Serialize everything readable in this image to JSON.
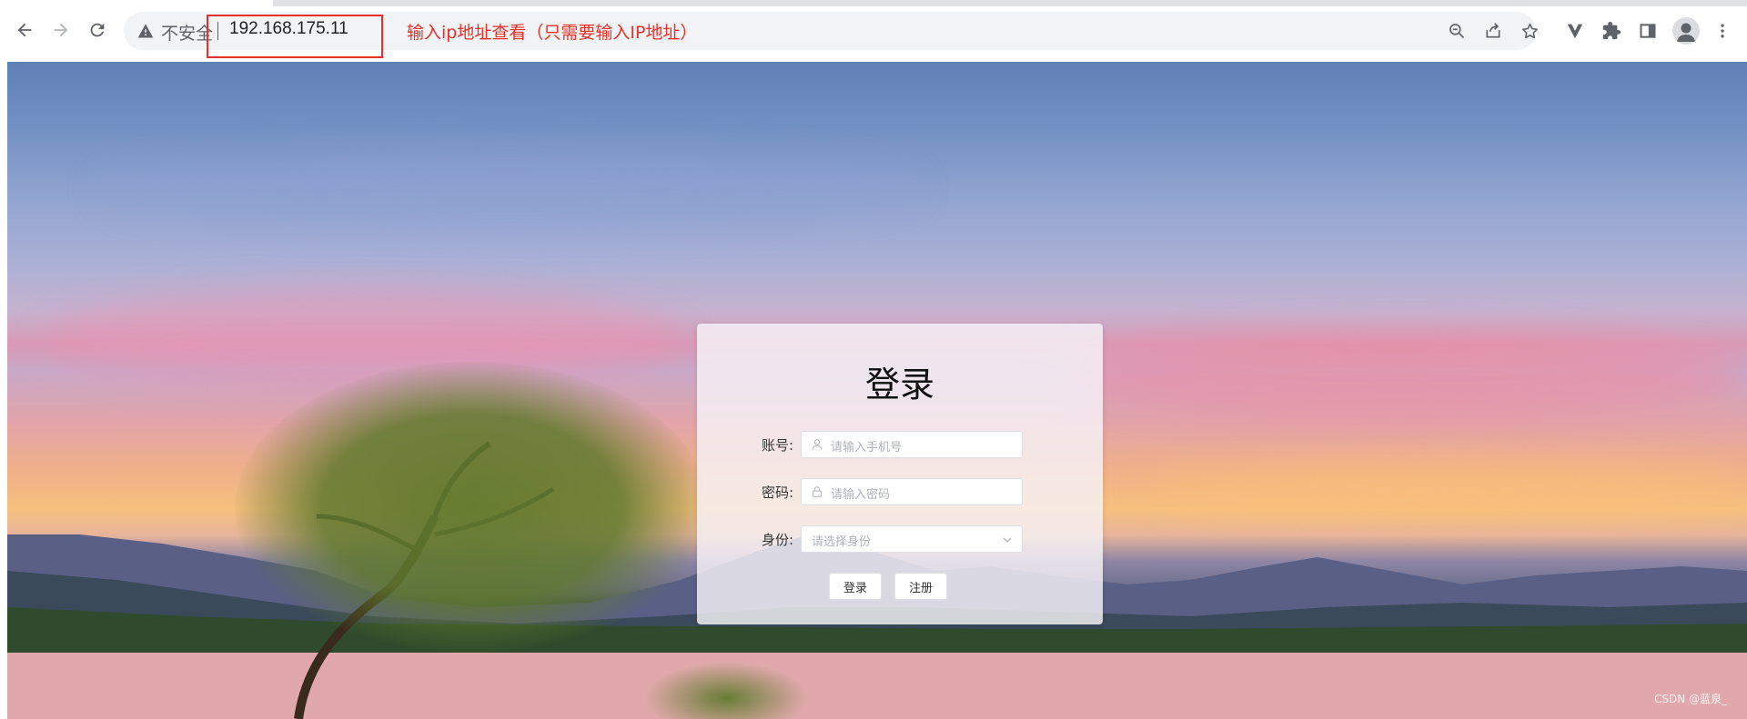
{
  "browser": {
    "security_label": "不安全",
    "url": "192.168.175.11",
    "annotation": "输入ip地址查看（只需要输入IP地址）",
    "icons": [
      "back-icon",
      "forward-icon",
      "reload-icon",
      "warning-icon",
      "zoom-out-icon",
      "share-icon",
      "bookmark-star-icon",
      "vpn-extension-icon",
      "extensions-puzzle-icon",
      "side-panel-icon",
      "profile-avatar-icon",
      "menu-kebab-icon"
    ],
    "annotation_color": "#e4322b"
  },
  "login": {
    "title": "登录",
    "account_label": "账号:",
    "account_placeholder": "请输入手机号",
    "password_label": "密码:",
    "password_placeholder": "请输入密码",
    "identity_label": "身份:",
    "identity_placeholder": "请选择身份",
    "login_button": "登录",
    "register_button": "注册"
  },
  "watermark": "CSDN @蓝泉_"
}
